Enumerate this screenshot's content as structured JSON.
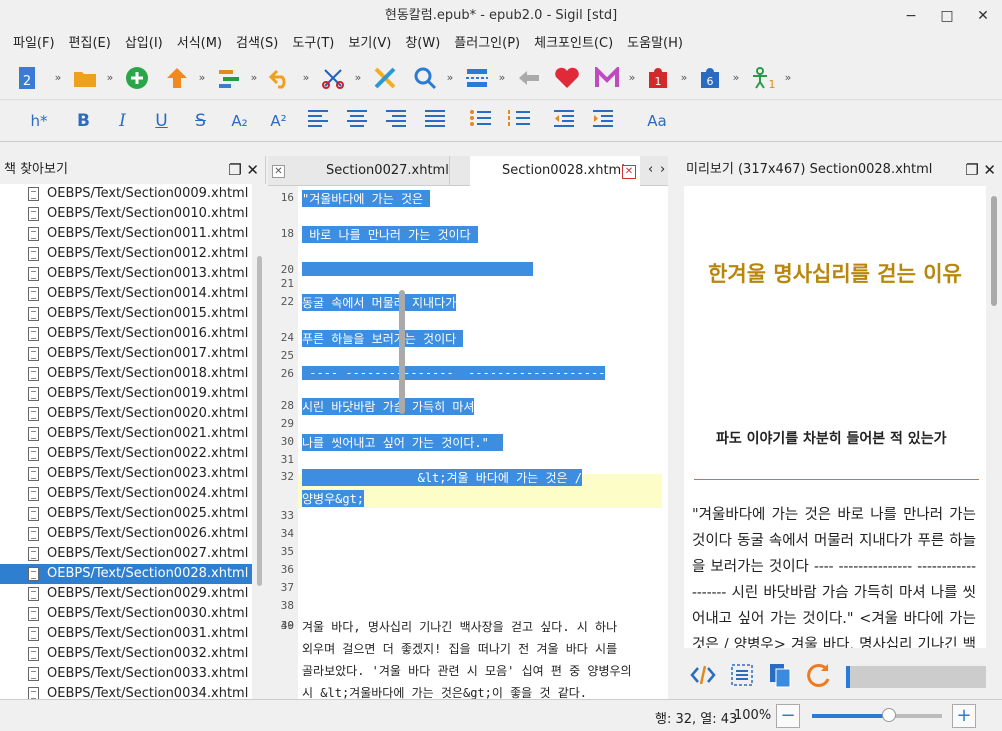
{
  "window": {
    "title": "현동칼럼.epub* - epub2.0 - Sigil [std]",
    "minimize": "−",
    "maximize": "□",
    "close": "✕"
  },
  "menu": [
    "파일(F)",
    "편집(E)",
    "삽입(I)",
    "서식(M)",
    "검색(S)",
    "도구(T)",
    "보기(V)",
    "창(W)",
    "플러그인(P)",
    "체크포인트(C)",
    "도움말(H)"
  ],
  "toolbar": {
    "more": "»",
    "icons": [
      "new-file-icon",
      "open-folder-icon",
      "add-icon",
      "upload-icon",
      "move-icon",
      "undo-icon",
      "cut-icon",
      "validate-icon",
      "search-icon",
      "split-icon",
      "back-icon",
      "heart-icon",
      "m-icon",
      "plugin-1-icon",
      "plugin-6-icon",
      "plugin-1b-icon"
    ],
    "badges": {
      "new": "2",
      "p1": "1",
      "p6": "6",
      "p1b": "1"
    }
  },
  "format_toolbar": {
    "heading": "h*",
    "bold": "B",
    "italic": "I",
    "underline": "U",
    "strike": "S",
    "subscript": "A₂",
    "superscript": "A²",
    "case": "Aa"
  },
  "book_browser": {
    "title": "책 찾아보기",
    "files": [
      "OEBPS/Text/Section0009.xhtml",
      "OEBPS/Text/Section0010.xhtml",
      "OEBPS/Text/Section0011.xhtml",
      "OEBPS/Text/Section0012.xhtml",
      "OEBPS/Text/Section0013.xhtml",
      "OEBPS/Text/Section0014.xhtml",
      "OEBPS/Text/Section0015.xhtml",
      "OEBPS/Text/Section0016.xhtml",
      "OEBPS/Text/Section0017.xhtml",
      "OEBPS/Text/Section0018.xhtml",
      "OEBPS/Text/Section0019.xhtml",
      "OEBPS/Text/Section0020.xhtml",
      "OEBPS/Text/Section0021.xhtml",
      "OEBPS/Text/Section0022.xhtml",
      "OEBPS/Text/Section0023.xhtml",
      "OEBPS/Text/Section0024.xhtml",
      "OEBPS/Text/Section0025.xhtml",
      "OEBPS/Text/Section0026.xhtml",
      "OEBPS/Text/Section0027.xhtml",
      "OEBPS/Text/Section0028.xhtml",
      "OEBPS/Text/Section0029.xhtml",
      "OEBPS/Text/Section0030.xhtml",
      "OEBPS/Text/Section0031.xhtml",
      "OEBPS/Text/Section0032.xhtml",
      "OEBPS/Text/Section0033.xhtml",
      "OEBPS/Text/Section0034.xhtml"
    ],
    "selected": "OEBPS/Text/Section0028.xhtml"
  },
  "tabs": [
    {
      "label": "Section0027.xhtml",
      "active": false
    },
    {
      "label": "Section0028.xhtml",
      "active": true
    }
  ],
  "editor": {
    "lines": [
      {
        "n": "16",
        "text": "\"겨울바다에 가는 것은 ",
        "hl": true
      },
      {
        "n": "18",
        "text": " 바로 나를 만나러 가는 것이다 ",
        "hl": true
      },
      {
        "n": "20",
        "text": "                                ",
        "hl": true
      },
      {
        "n": "21",
        "text": "",
        "hl": false
      },
      {
        "n": "22",
        "text": "동굴 속에서 머물러 지내다가",
        "hl": true
      },
      {
        "n": "24",
        "text": "푸른 하늘을 보러가는 것이다 ",
        "hl": true
      },
      {
        "n": "25",
        "text": "",
        "hl": false
      },
      {
        "n": "26",
        "text": " ---- ---------------  -------------------",
        "hl": true
      },
      {
        "n": "28",
        "text": "시린 바닷바람 가슴 가득히 마셔",
        "hl": true
      },
      {
        "n": "29",
        "text": "",
        "hl": false
      },
      {
        "n": "30",
        "text": "나를 씻어내고 싶어 가는 것이다.\"  ",
        "hl": true
      },
      {
        "n": "31",
        "text": "",
        "hl": false
      },
      {
        "n": "32",
        "text": "                &lt;겨울 바다에 가는 것은 /",
        "hl": true
      },
      {
        "n": "",
        "text": "양병우&gt;",
        "hl": true
      },
      {
        "n": "33",
        "text": "",
        "hl": false
      },
      {
        "n": "34",
        "text": "",
        "hl": false
      },
      {
        "n": "35",
        "text": "",
        "hl": false
      },
      {
        "n": "36",
        "text": "",
        "hl": false
      },
      {
        "n": "37",
        "text": "",
        "hl": false
      },
      {
        "n": "38",
        "text": "",
        "hl": false
      },
      {
        "n": "39",
        "text": "",
        "hl": false
      },
      {
        "n": "40",
        "text": "겨울 바다, 명사십리 기나긴 백사장을 걷고 싶다. 시 하나",
        "hl": false
      },
      {
        "n": "",
        "text": "외우며 걸으면 더 좋겠지! 집을 떠나기 전 겨울 바다 시를",
        "hl": false
      },
      {
        "n": "",
        "text": "골라보았다. '겨울 바다 관련 시 모음' 십여 편 중 양병우의",
        "hl": false
      },
      {
        "n": "",
        "text": "시 &lt;겨울바다에 가는 것은&gt;이 좋을 것 같다.",
        "hl": false
      }
    ]
  },
  "preview": {
    "header": "미리보기 (317x467) Section0028.xhtml",
    "title": "한겨울 명사십리를 걷는 이유",
    "subtitle": "파도 이야기를 차분히 들어본 적 있는가",
    "body": "\"겨울바다에 가는 것은 바로 나를 만나러 가는 것이다 동굴 속에서 머물러 지내다가 푸른 하늘을 보러가는 것이다 ---- --------------- ------------------- 시린 바닷바람 가슴 가득히 마셔 나를 씻어내고 싶어 가는 것이다.\" <겨울 바다에 가는 것은 / 양병우> 겨울 바다, 명사십리 기나긴 백사장"
  },
  "status": {
    "position": "행: 32, 열: 43",
    "zoom": "100%",
    "zoom_level": 0.59,
    "minus": "−",
    "plus": "+"
  },
  "colors": {
    "selection": "#3d8ee0",
    "title": "#b8860b",
    "sel_row": "#2f7fd1"
  }
}
